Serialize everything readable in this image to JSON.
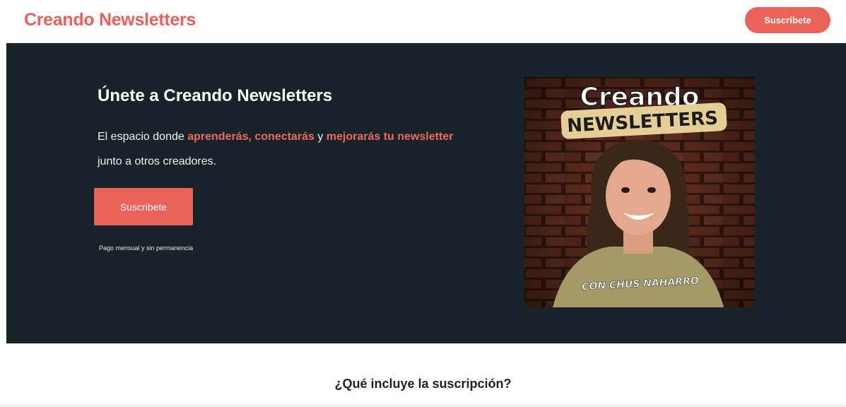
{
  "header": {
    "brand": "Creando Newsletters",
    "subscribe_label": "Suscribete"
  },
  "hero": {
    "title": "Únete a Creando Newsletters",
    "desc_part1": "El espacio donde ",
    "desc_hl1": "aprenderás, conectarás",
    "desc_part2": " y ",
    "desc_hl2": "mejorarás tu newsletter",
    "desc_part3": "junto a otros creadores.",
    "button_label": "Suscribete",
    "note": "Pago mensual y sin permanencia",
    "cover": {
      "line1": "Creando",
      "line2": "NEWSLETTERS",
      "line3": "CON CHUS NAHARRO"
    }
  },
  "section": {
    "title": "¿Qué incluye la suscripción?"
  },
  "colors": {
    "accent": "#ea625a",
    "hero_bg": "#172329",
    "brand": "#e8615c"
  }
}
